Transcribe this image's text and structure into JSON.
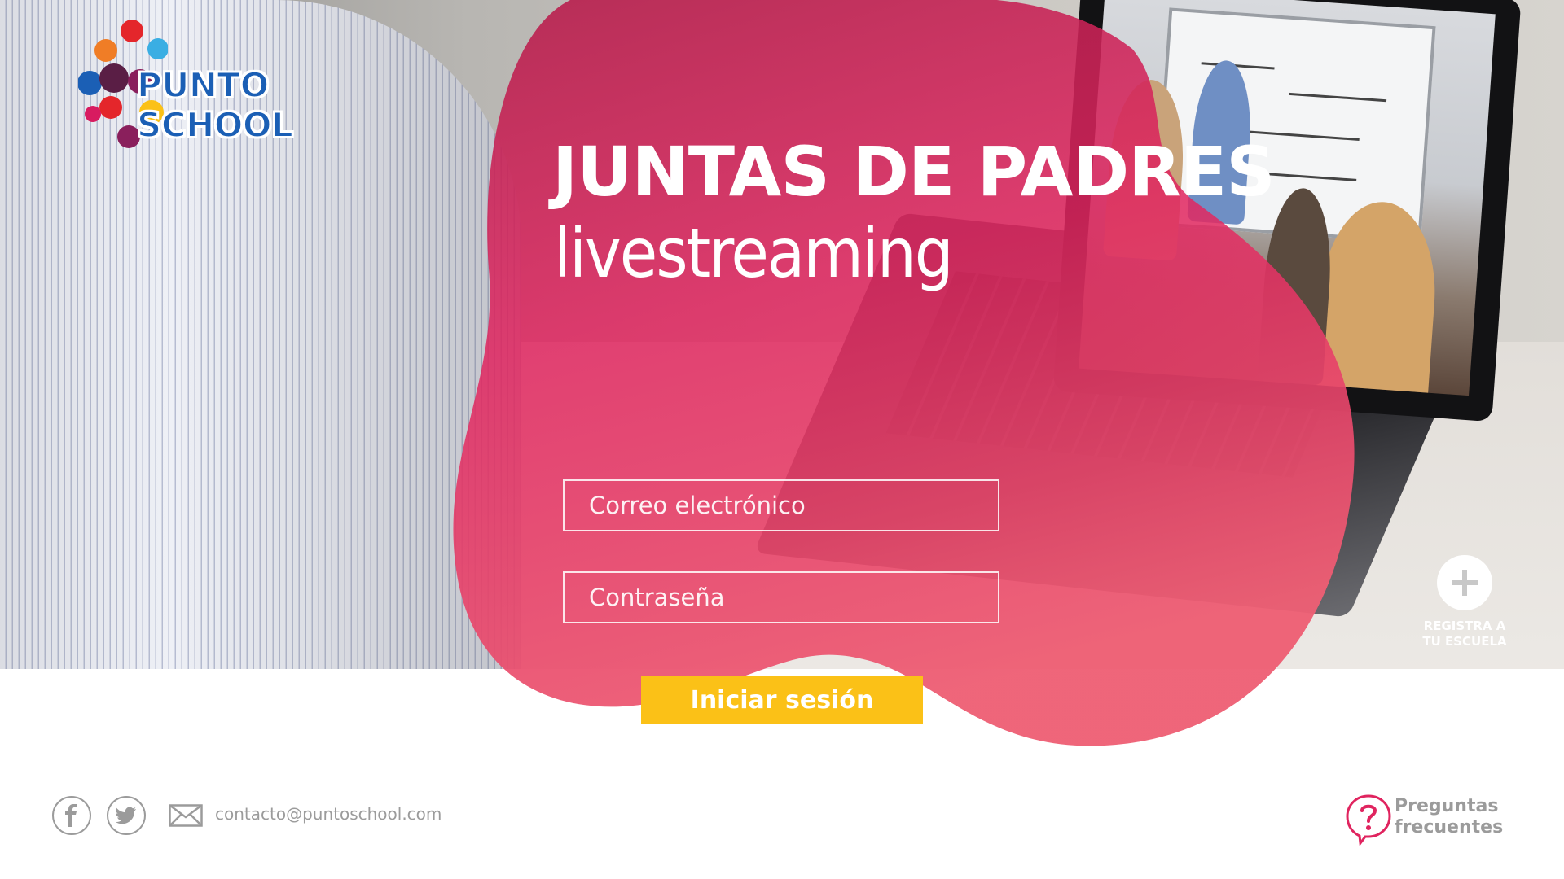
{
  "brand": {
    "name": "PUNTO SCHOOL",
    "logo_colors": [
      "#e4262b",
      "#f07d26",
      "#fbc117",
      "#3aaee3",
      "#1b5fb5",
      "#8a1f5c",
      "#5a1e45",
      "#d81b60"
    ]
  },
  "hero": {
    "title": "JUNTAS DE PADRES",
    "subtitle": "livestreaming"
  },
  "login": {
    "email_placeholder": "Correo electrónico",
    "password_placeholder": "Contraseña",
    "submit_label": "Iniciar sesión"
  },
  "register": {
    "icon": "plus-icon",
    "label_line1": "REGISTRA A",
    "label_line2": "TU ESCUELA"
  },
  "footer": {
    "social": [
      {
        "name": "facebook",
        "icon": "facebook-icon"
      },
      {
        "name": "twitter",
        "icon": "twitter-icon"
      }
    ],
    "contact_icon": "mail-icon",
    "contact_email": "contacto@puntoschool.com",
    "faq_icon": "question-bubble-icon",
    "faq_line1": "Preguntas",
    "faq_line2": "frecuentes"
  },
  "colors": {
    "blob_top": "#b5214e",
    "blob_mid": "#e0245f",
    "blob_bottom": "#ee5f74",
    "button_yellow": "#fbc117",
    "footer_gray": "#9b9b9b",
    "faq_pink": "#e0245f"
  }
}
